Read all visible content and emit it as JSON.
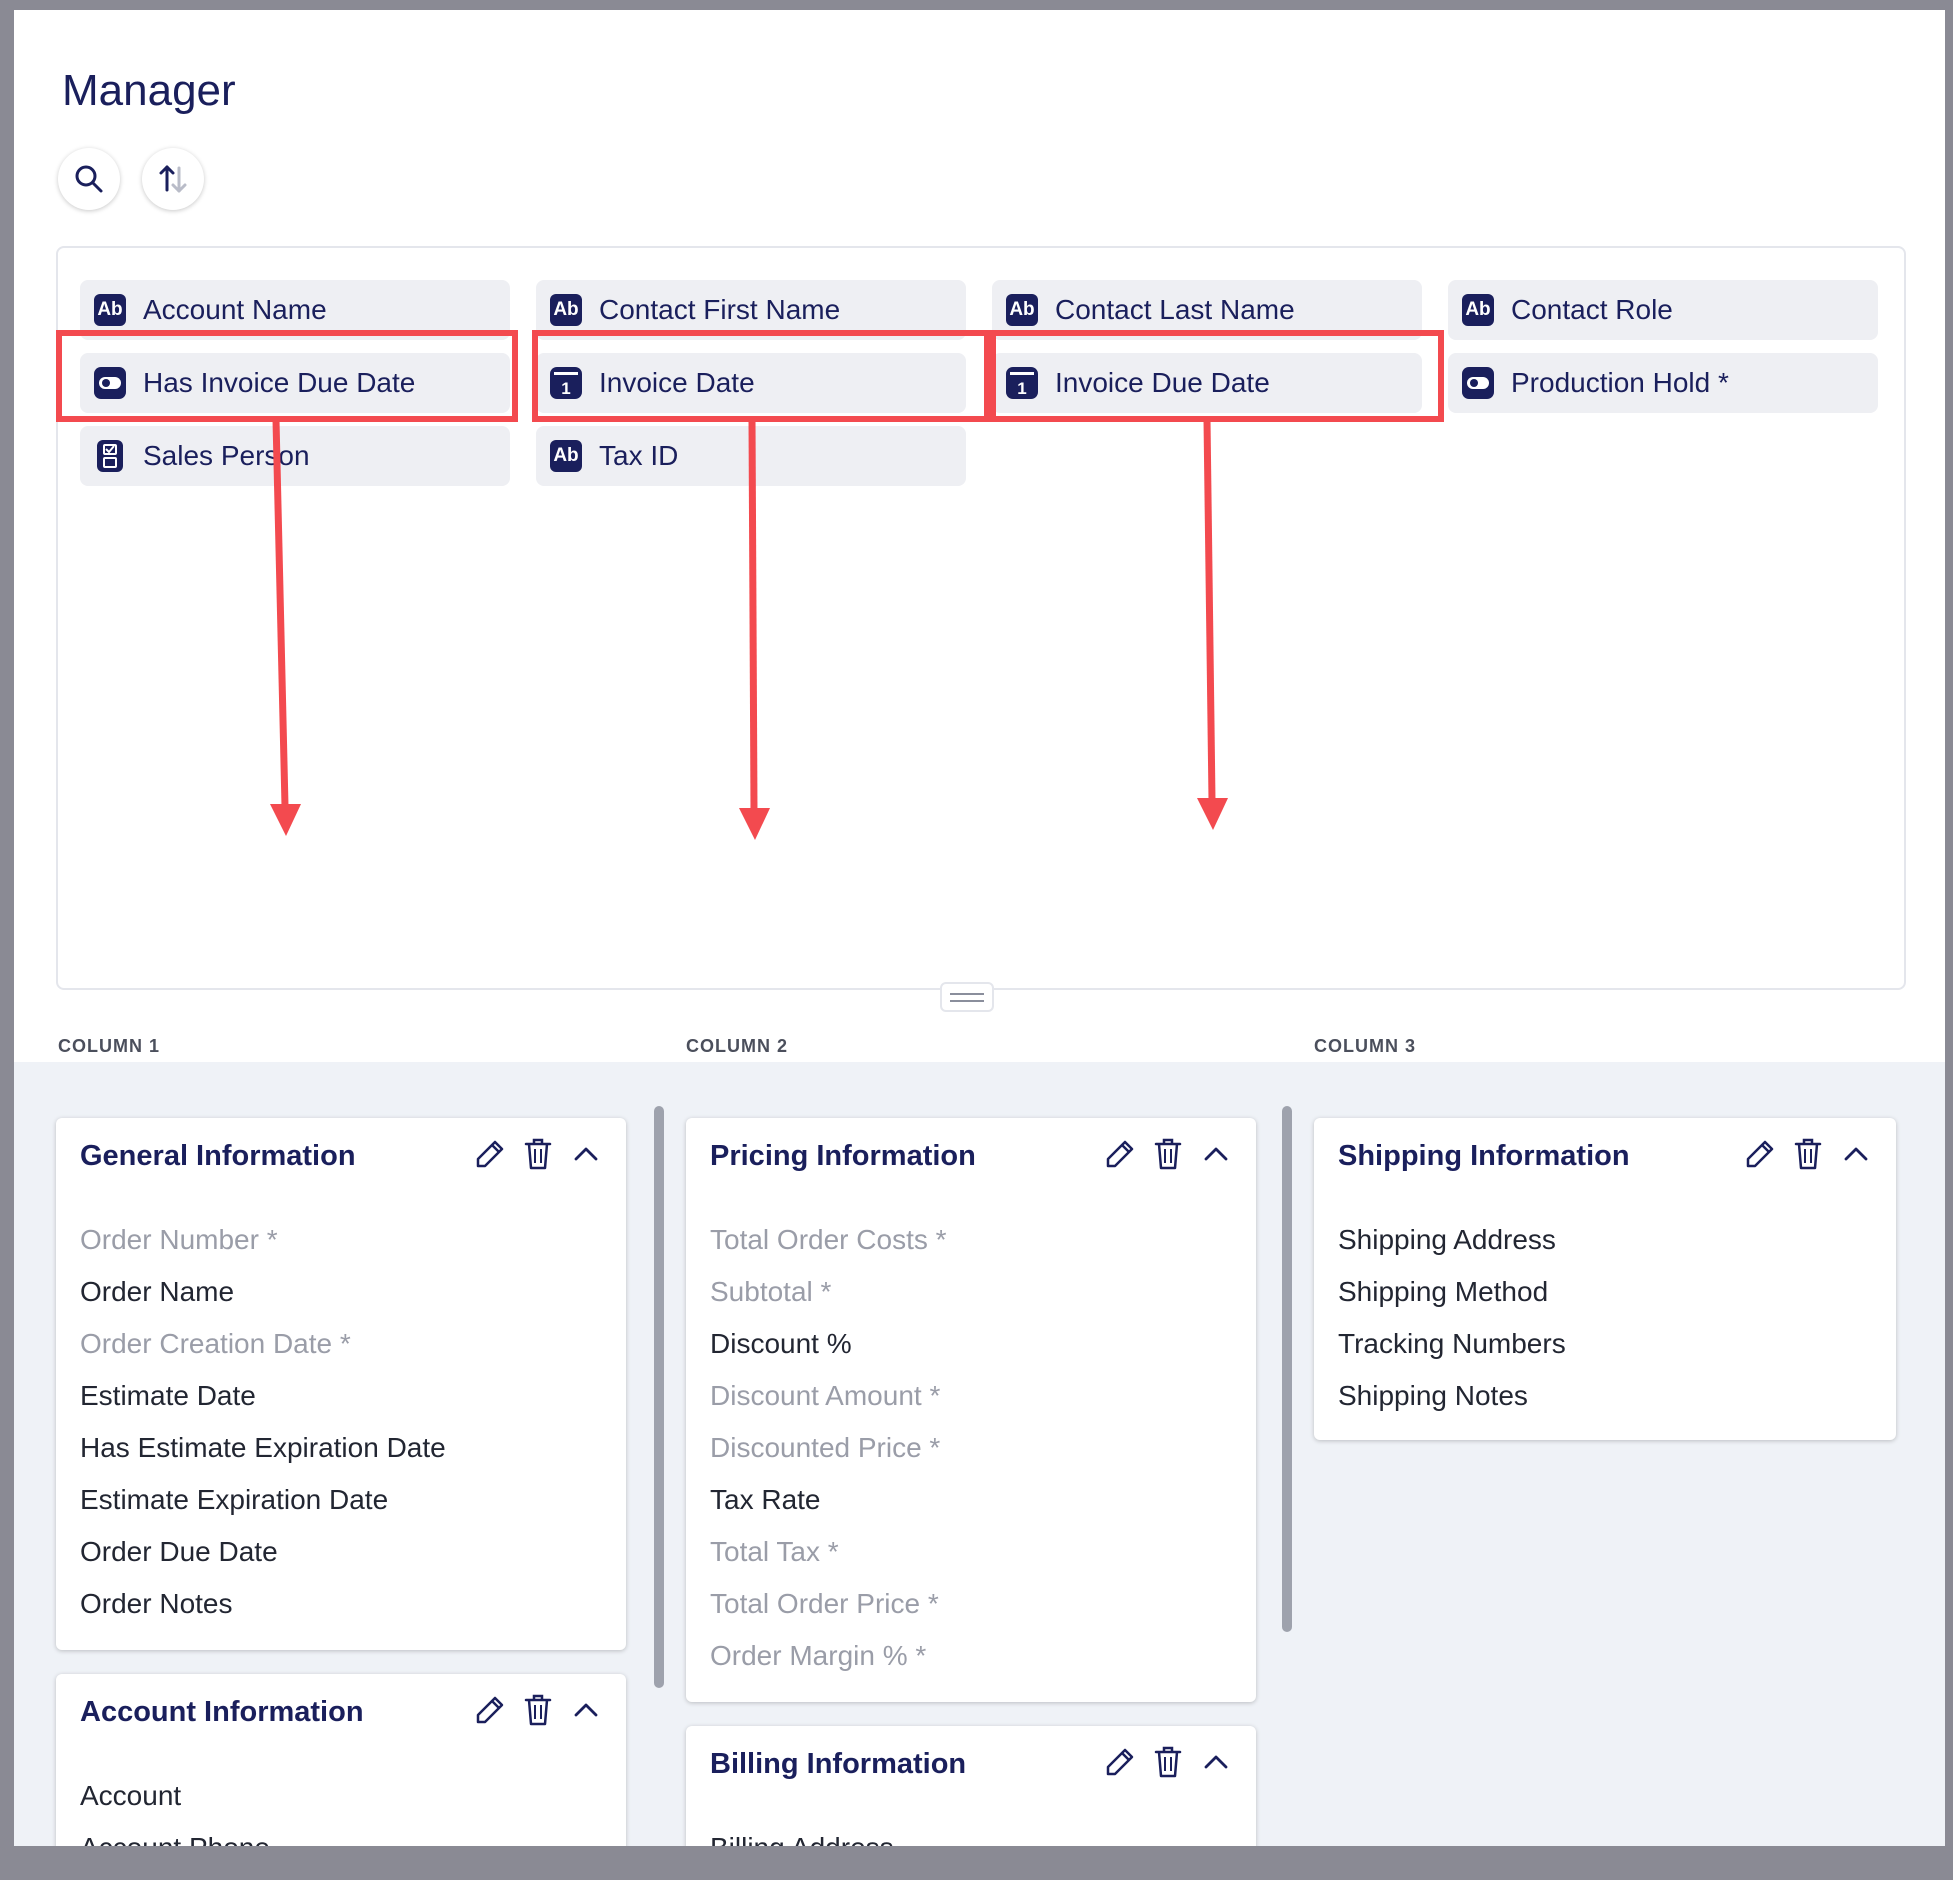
{
  "page": {
    "title": "Manager"
  },
  "toolbar": {
    "search_icon": "search-icon",
    "sort_icon": "sort-icon"
  },
  "colors": {
    "navy": "#1a1f5c",
    "highlight_red": "#f34a4f",
    "muted_text": "#9a9da8"
  },
  "palette": {
    "chips": [
      {
        "label": "Account Name",
        "icon": "text-type-icon",
        "icon_text": "Ab"
      },
      {
        "label": "Contact First Name",
        "icon": "text-type-icon",
        "icon_text": "Ab"
      },
      {
        "label": "Contact Last Name",
        "icon": "text-type-icon",
        "icon_text": "Ab"
      },
      {
        "label": "Contact Role",
        "icon": "text-type-icon",
        "icon_text": "Ab"
      },
      {
        "label": "Has Invoice Due Date",
        "icon": "toggle-type-icon",
        "highlighted": true
      },
      {
        "label": "Invoice Date",
        "icon": "calendar-type-icon",
        "icon_text": "1",
        "highlighted": true
      },
      {
        "label": "Invoice Due Date",
        "icon": "calendar-type-icon",
        "icon_text": "1",
        "highlighted": true
      },
      {
        "label": "Production Hold *",
        "icon": "toggle-type-icon"
      },
      {
        "label": "Sales Person",
        "icon": "select-type-icon"
      },
      {
        "label": "Tax ID",
        "icon": "text-type-icon",
        "icon_text": "Ab"
      }
    ]
  },
  "columns": [
    {
      "label": "COLUMN 1"
    },
    {
      "label": "COLUMN 2"
    },
    {
      "label": "COLUMN 3"
    }
  ],
  "cards": {
    "general": {
      "title": "General Information",
      "fields": [
        {
          "label": "Order Number *",
          "required": true
        },
        {
          "label": "Order Name",
          "required": false
        },
        {
          "label": "Order Creation Date *",
          "required": true
        },
        {
          "label": "Estimate Date",
          "required": false
        },
        {
          "label": "Has Estimate Expiration Date",
          "required": false
        },
        {
          "label": "Estimate Expiration Date",
          "required": false
        },
        {
          "label": "Order Due Date",
          "required": false
        },
        {
          "label": "Order Notes",
          "required": false
        }
      ]
    },
    "account": {
      "title": "Account Information",
      "fields": [
        {
          "label": "Account",
          "required": false
        },
        {
          "label": "Account Phone",
          "required": false
        }
      ]
    },
    "pricing": {
      "title": "Pricing Information",
      "fields": [
        {
          "label": "Total Order Costs *",
          "required": true
        },
        {
          "label": "Subtotal *",
          "required": true
        },
        {
          "label": "Discount %",
          "required": false
        },
        {
          "label": "Discount Amount *",
          "required": true
        },
        {
          "label": "Discounted Price *",
          "required": true
        },
        {
          "label": "Tax Rate",
          "required": false
        },
        {
          "label": "Total Tax *",
          "required": true
        },
        {
          "label": "Total Order Price *",
          "required": true
        },
        {
          "label": "Order Margin % *",
          "required": true
        }
      ]
    },
    "billing": {
      "title": "Billing Information",
      "fields": [
        {
          "label": "Billing Address",
          "required": false
        }
      ]
    },
    "shipping": {
      "title": "Shipping Information",
      "fields": [
        {
          "label": "Shipping Address",
          "required": false
        },
        {
          "label": "Shipping Method",
          "required": false
        },
        {
          "label": "Tracking Numbers",
          "required": false
        },
        {
          "label": "Shipping Notes",
          "required": false
        }
      ]
    }
  },
  "card_actions": {
    "edit_icon": "pencil-icon",
    "delete_icon": "trash-icon",
    "collapse_icon": "chevron-up-icon"
  }
}
